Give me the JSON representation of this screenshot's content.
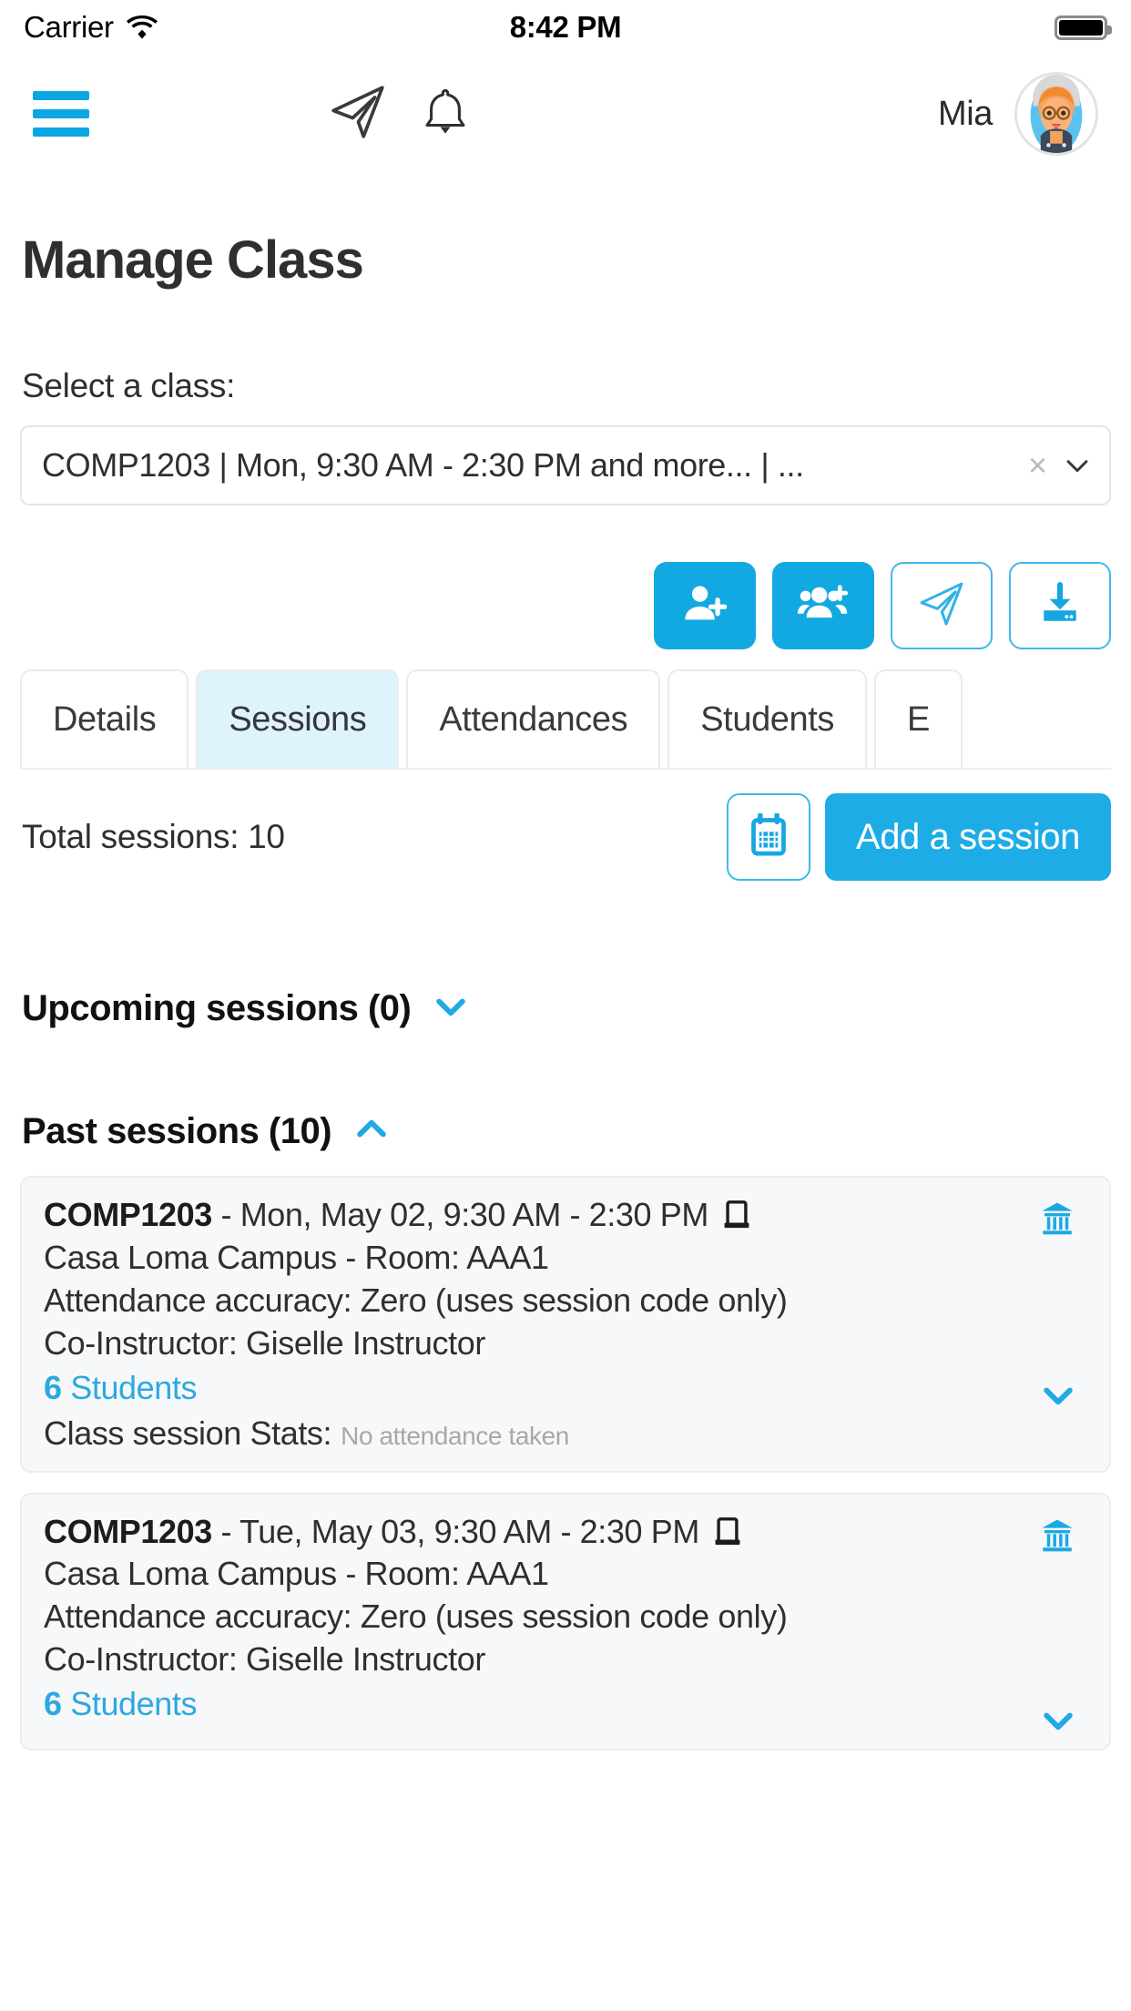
{
  "status_bar": {
    "carrier": "Carrier",
    "time": "8:42 PM",
    "wifi_icon": "wifi-icon",
    "battery_icon": "battery-full-icon"
  },
  "header": {
    "menu_icon": "hamburger-menu-icon",
    "send_icon": "paper-plane-icon",
    "notifications_icon": "bell-icon",
    "user_name": "Mia",
    "avatar_icon": "user-avatar"
  },
  "page": {
    "title": "Manage Class",
    "select_label": "Select a class:",
    "selected_class": "COMP1203 | Mon, 9:30 AM - 2:30 PM and more... | ...",
    "clear_symbol": "×",
    "caret_icon": "chevron-down-icon"
  },
  "actions": [
    {
      "name": "add-student-button",
      "icon": "user-plus-icon",
      "style": "filled"
    },
    {
      "name": "add-group-button",
      "icon": "users-plus-icon",
      "style": "filled"
    },
    {
      "name": "send-message-button",
      "icon": "paper-plane-icon",
      "style": "outline"
    },
    {
      "name": "import-download-button",
      "icon": "download-inbox-icon",
      "style": "outline"
    }
  ],
  "tabs": [
    {
      "label": "Details",
      "active": false
    },
    {
      "label": "Sessions",
      "active": true
    },
    {
      "label": "Attendances",
      "active": false
    },
    {
      "label": "Students",
      "active": false
    },
    {
      "label": "E",
      "active": false
    }
  ],
  "sessions_panel": {
    "total_label": "Total sessions: 10",
    "calendar_icon": "calendar-icon",
    "add_session_label": "Add a session",
    "upcoming_title": "Upcoming sessions (0)",
    "upcoming_caret": "chevron-down-icon",
    "past_title": "Past sessions (10)",
    "past_caret": "chevron-up-icon"
  },
  "session_cards": [
    {
      "course_code": "COMP1203",
      "schedule": "- Mon, May 02, 9:30 AM - 2:30 PM",
      "mode_icon": "laptop-icon",
      "campus_icon": "bank-institution-icon",
      "location": "Casa Loma Campus - Room: AAA1",
      "accuracy": "Attendance accuracy: Zero (uses session code only)",
      "co_instructor": "Co-Instructor: Giselle Instructor",
      "students_count": "6",
      "students_label": " Students",
      "stats_label": "Class session Stats:",
      "stats_value": "No attendance taken",
      "expand_caret": "chevron-down-icon"
    },
    {
      "course_code": "COMP1203",
      "schedule": "- Tue, May 03, 9:30 AM - 2:30 PM",
      "mode_icon": "laptop-icon",
      "campus_icon": "bank-institution-icon",
      "location": "Casa Loma Campus - Room: AAA1",
      "accuracy": "Attendance accuracy: Zero (uses session code only)",
      "co_instructor": "Co-Instructor: Giselle Instructor",
      "students_count": "6",
      "students_label": " Students",
      "expand_caret": "chevron-down-icon"
    }
  ],
  "colors": {
    "accent": "#12a9e3",
    "accent_light": "#dff3fc",
    "link": "#2da9e0",
    "card_bg": "#f7f8f9",
    "text": "#2f2f2f",
    "muted": "#a8a8a8"
  }
}
